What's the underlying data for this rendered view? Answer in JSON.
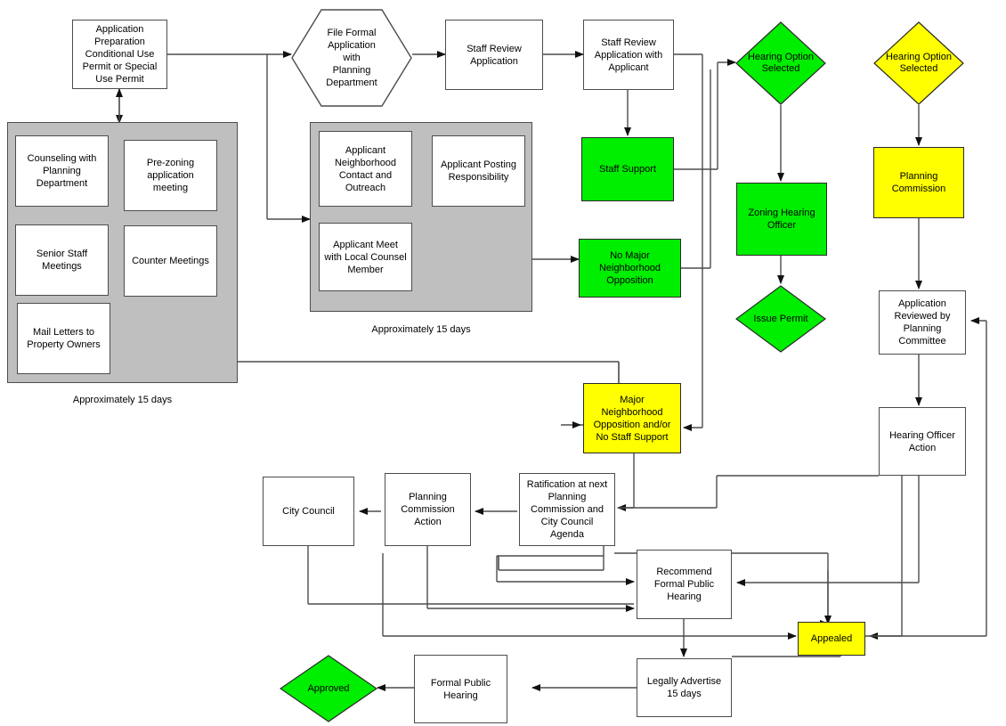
{
  "diagram": {
    "title": "Conditional Use / Special Use Permit Process Flowchart",
    "colors": {
      "green": "#00EE00",
      "yellow": "#FFFF00",
      "group_gray": "#BFBFBF",
      "line": "#4D4D4D",
      "white": "#FFFFFF"
    }
  },
  "nodes": {
    "application_preparation": "Application\nPreparation\nConditional Use\nPermit or Special\nUse Permit",
    "file_formal_application": "File Formal\nApplication\nwith\nPlanning\nDepartment",
    "staff_review_application": "Staff Review\nApplication",
    "staff_review_with_applicant": "Staff Review\nApplication with\nApplicant",
    "staff_support": "Staff Support",
    "no_major_opposition": "No Major\nNeighborhood\nOpposition",
    "major_opposition": "Major\nNeighborhood\nOpposition and/or\nNo Staff Support",
    "hearing_option_selected_green": "Hearing Option\nSelected",
    "zoning_hearing_officer": "Zoning Hearing\nOfficer",
    "issue_permit": "Issue Permit",
    "hearing_option_selected_yellow": "Hearing Option\nSelected",
    "planning_commission": "Planning\nCommission",
    "application_reviewed": "Application\nReviewed by\nPlanning\nCommittee",
    "hearing_officer_action": "Hearing Officer\nAction",
    "appealed": "Appealed",
    "city_council": "City Council",
    "planning_commission_action": "Planning\nCommission\nAction",
    "ratification": "Ratification at next\nPlanning\nCommission and\nCity Council\nAgenda",
    "recommend_formal_public_hearing": "Recommend\nFormal Public\nHearing",
    "legally_advertise": "Legally Advertise\n15 days",
    "formal_public_hearing": "Formal Public\nHearing",
    "approved": "Approved"
  },
  "groups": {
    "preapp": {
      "caption": "Approximately 15 days",
      "items": {
        "counseling": "Counseling with\nPlanning\nDepartment",
        "prezoning": "Pre-zoning\napplication\nmeeting",
        "senior_staff": "Senior Staff\nMeetings",
        "counter": "Counter Meetings",
        "mail_letters": "Mail Letters to\nProperty Owners"
      }
    },
    "outreach": {
      "caption": "Approximately 15 days",
      "items": {
        "neighborhood_contact": "Applicant\nNeighborhood\nContact and\nOutreach",
        "posting": "Applicant Posting\nResponsibility",
        "local_counsel": "Applicant Meet\nwith Local Counsel\nMember"
      }
    }
  }
}
